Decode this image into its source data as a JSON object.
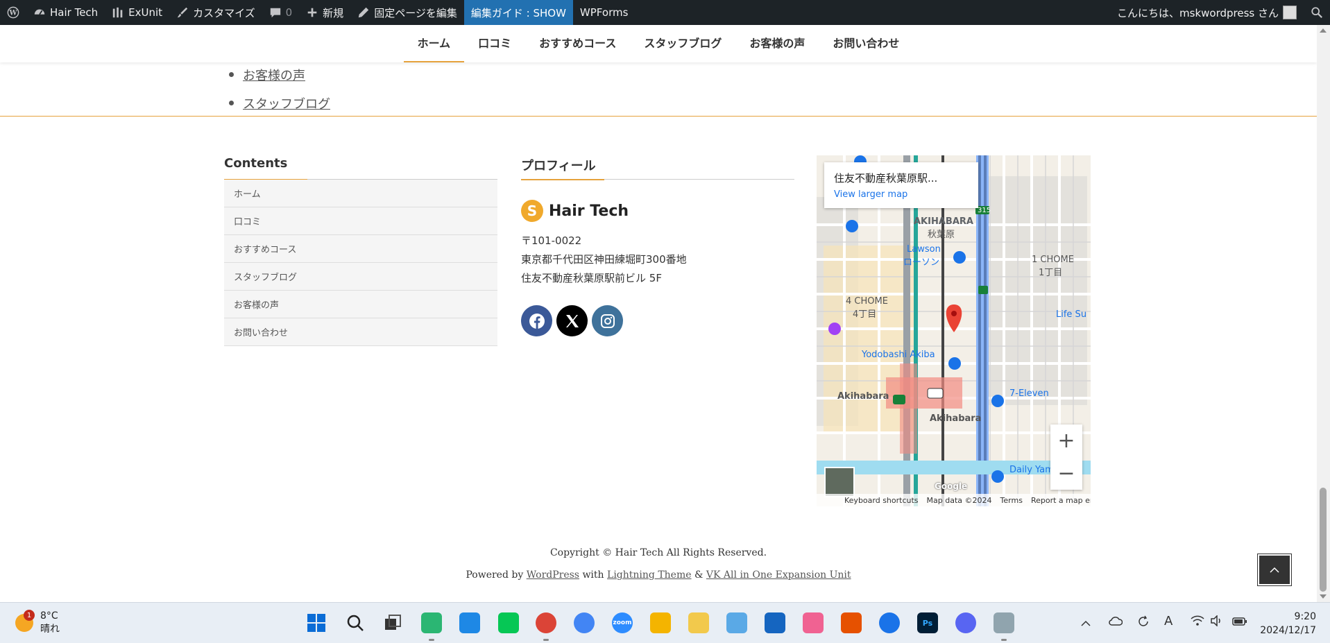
{
  "adminbar": {
    "site": "Hair Tech",
    "exunit": "ExUnit",
    "customize": "カスタマイズ",
    "comments_count": "0",
    "new": "新規",
    "edit_page": "固定ページを編集",
    "edit_guide": "編集ガイド : SHOW",
    "wpforms": "WPForms",
    "greeting": "こんにちは、mskwordpress さん"
  },
  "nav": {
    "items": [
      "ホーム",
      "口コミ",
      "おすすめコース",
      "スタッフブログ",
      "お客様の声",
      "お問い合わせ"
    ]
  },
  "toplist": [
    "お客様の声",
    "スタッフブログ"
  ],
  "contents_widget": {
    "title": "Contents",
    "items": [
      "ホーム",
      "口コミ",
      "おすすめコース",
      "スタッフブログ",
      "お客様の声",
      "お問い合わせ"
    ]
  },
  "profile_widget": {
    "title": "プロフィール",
    "logo_text": "Hair Tech",
    "postal": "〒101-0022",
    "address1": "東京都千代田区神田練堀町300番地",
    "address2": "住友不動産秋葉原駅前ビル 5F",
    "social_icons": [
      "facebook-icon",
      "x-icon",
      "instagram-icon"
    ]
  },
  "map": {
    "place_name": "住友不動産秋葉原駅...",
    "larger_map": "View larger map",
    "labels": {
      "akihabara": "AKIHABARA",
      "akihabara_jp": "秋葉原",
      "lawson": "Lawson",
      "lawson_jp": "ローソン",
      "chome4": "4 CHOME",
      "chome4_jp": "4丁目",
      "chome1": "1 CHOME",
      "chome1_jp": "1丁目",
      "yodobashi": "Yodobashi Akiba",
      "akihabara_st": "Akihabara",
      "akihabara_st2": "Akihabara",
      "seven": "7-Eleven",
      "daily": "Daily Yam",
      "life": "Life Su",
      "route": "315"
    },
    "attribution": [
      "Keyboard shortcuts",
      "Map data ©2024",
      "Terms",
      "Report a map error"
    ],
    "google": "Google"
  },
  "footer": {
    "copyright": "Copyright © Hair Tech All Rights Reserved.",
    "powered_prefix": "Powered by",
    "wordpress": "WordPress",
    "with": "with",
    "lightning": "Lightning Theme",
    "amp": "&",
    "vk": "VK All in One Expansion Unit"
  },
  "taskbar": {
    "weather_temp": "8°C",
    "weather_desc": "晴れ",
    "weather_badge": "1",
    "time": "9:20",
    "date": "2024/12/17",
    "zoom_label": "zoom",
    "ps_label": "Ps"
  },
  "colors": {
    "accent": "#e6a23c",
    "adminbar": "#1d2327",
    "highlight": "#2271b1",
    "facebook": "#3b5998",
    "x": "#000000",
    "instagram": "#3f729b"
  }
}
